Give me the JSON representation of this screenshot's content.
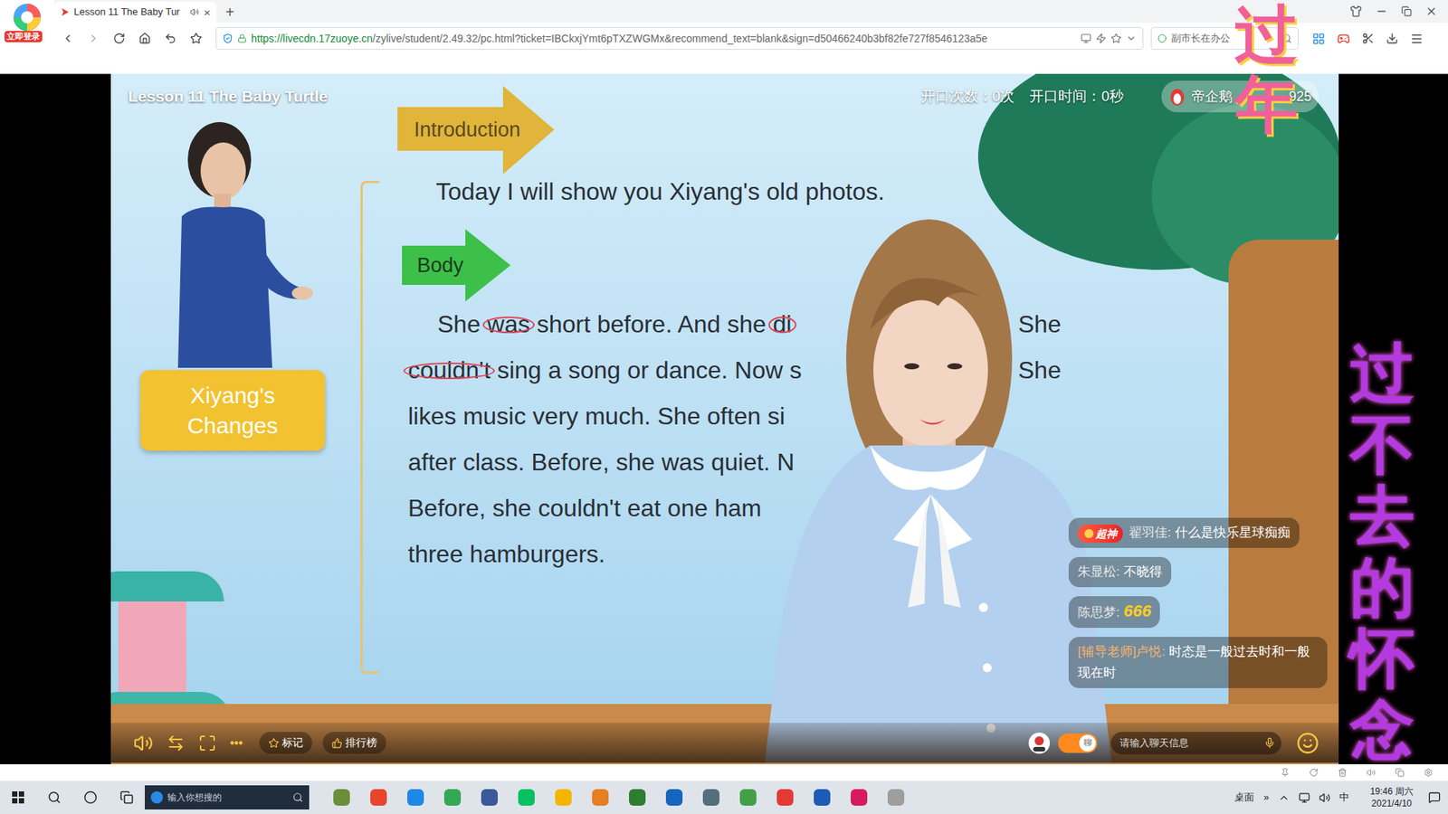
{
  "browser": {
    "login_badge": "立即登录",
    "tab": {
      "title": "Lesson 11 The Baby Tur",
      "close": "×",
      "selected": true
    },
    "new_tab": "+",
    "address": {
      "scheme_host": "https://livecdn.17zuoye.cn",
      "path": "/zylive/student/2.49.32/pc.html?ticket=IBCkxjYmt6pTXZWGMx&recommend_text=blank&sign=d50466240b3bf82fe727f8546123a5e"
    },
    "search": "副市长在办公"
  },
  "lesson": {
    "title": "Lesson 11 The Baby Turtle",
    "speak_count": "开口次数：0次",
    "speak_time": "开口时间：0秒",
    "badge_name": "帝企鹅",
    "badge_score": "925"
  },
  "slide": {
    "introduction_label": "Introduction",
    "introduction_text": "Today I will show you Xiyang's old photos.",
    "body_label": "Body",
    "changes_label": "Xiyang's Changes",
    "lines": [
      {
        "indent": true,
        "segments": [
          {
            "text": "She ",
            "circled": false
          },
          {
            "text": "was",
            "circled": true
          },
          {
            "text": " short before. And she ",
            "circled": false
          },
          {
            "text": "di",
            "circled": true
          }
        ],
        "tail": "She"
      },
      {
        "indent": false,
        "segments": [
          {
            "text": "couldn't",
            "circled": true
          },
          {
            "text": " sing a song or dance. Now s",
            "circled": false
          }
        ],
        "tail": "She"
      },
      {
        "indent": false,
        "segments": [
          {
            "text": "likes music very much. She often si",
            "circled": false
          }
        ],
        "tail": ""
      },
      {
        "indent": false,
        "segments": [
          {
            "text": "after class. Before, she was quiet. N",
            "circled": false
          }
        ],
        "tail": ""
      },
      {
        "indent": false,
        "segments": [
          {
            "text": "Before, she couldn't eat one ham",
            "circled": false
          }
        ],
        "tail": ""
      },
      {
        "indent": false,
        "segments": [
          {
            "text": "three hamburgers.",
            "circled": false
          }
        ],
        "tail": ""
      }
    ]
  },
  "chat": {
    "messages": [
      {
        "badge": "超神",
        "name": "翟羽佳:",
        "text": "什么是快乐星球痴痴",
        "role": "student",
        "kind": "text"
      },
      {
        "badge": "",
        "name": "朱显松:",
        "text": "不晓得",
        "role": "student",
        "kind": "text"
      },
      {
        "badge": "",
        "name": "陈思梦:",
        "text": "666",
        "role": "student",
        "kind": "emote"
      },
      {
        "badge": "",
        "name": "[辅导老师]卢悦:",
        "text": "时态是一般过去时和一般现在时",
        "role": "teacher",
        "kind": "text"
      }
    ]
  },
  "controls": {
    "mark": "标记",
    "ranking": "排行榜",
    "more": "•••",
    "chat_toggle": {
      "label": "聊",
      "on": true
    },
    "input_placeholder": "请输入聊天信息"
  },
  "taskbar": {
    "search_placeholder": "输入你想搜的",
    "desktop": "桌面",
    "overflow": "»",
    "ime": "中",
    "time": "19:46 周六",
    "date": "2021/4/10"
  },
  "overlay": {
    "top": "过年",
    "side": "过不去的怀念"
  }
}
